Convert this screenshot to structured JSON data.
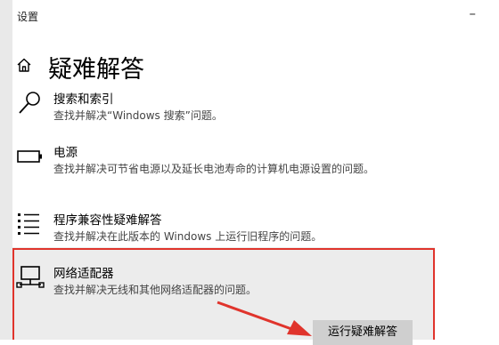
{
  "window": {
    "title": "设置",
    "minimize_glyph": "–"
  },
  "header": {
    "title": "疑难解答",
    "home_icon": "home-icon"
  },
  "items": [
    {
      "title": "搜索和索引",
      "desc": "查找并解决“Windows 搜索”问题。",
      "icon": "search-icon"
    },
    {
      "title": "电源",
      "desc": "查找并解决可节省电源以及延长电池寿命的计算机电源设置的问题。",
      "icon": "battery-icon"
    },
    {
      "title": "程序兼容性疑难解答",
      "desc": "查找并解决在此版本的 Windows 上运行旧程序的问题。",
      "icon": "list-icon"
    },
    {
      "title": "网络适配器",
      "desc": "查找并解决无线和其他网络适配器的问题。",
      "icon": "network-adapter-icon"
    }
  ],
  "actions": {
    "run_troubleshooter": "运行疑难解答"
  },
  "colors": {
    "highlight": "#e0342c",
    "selected_bg": "#ececec"
  }
}
